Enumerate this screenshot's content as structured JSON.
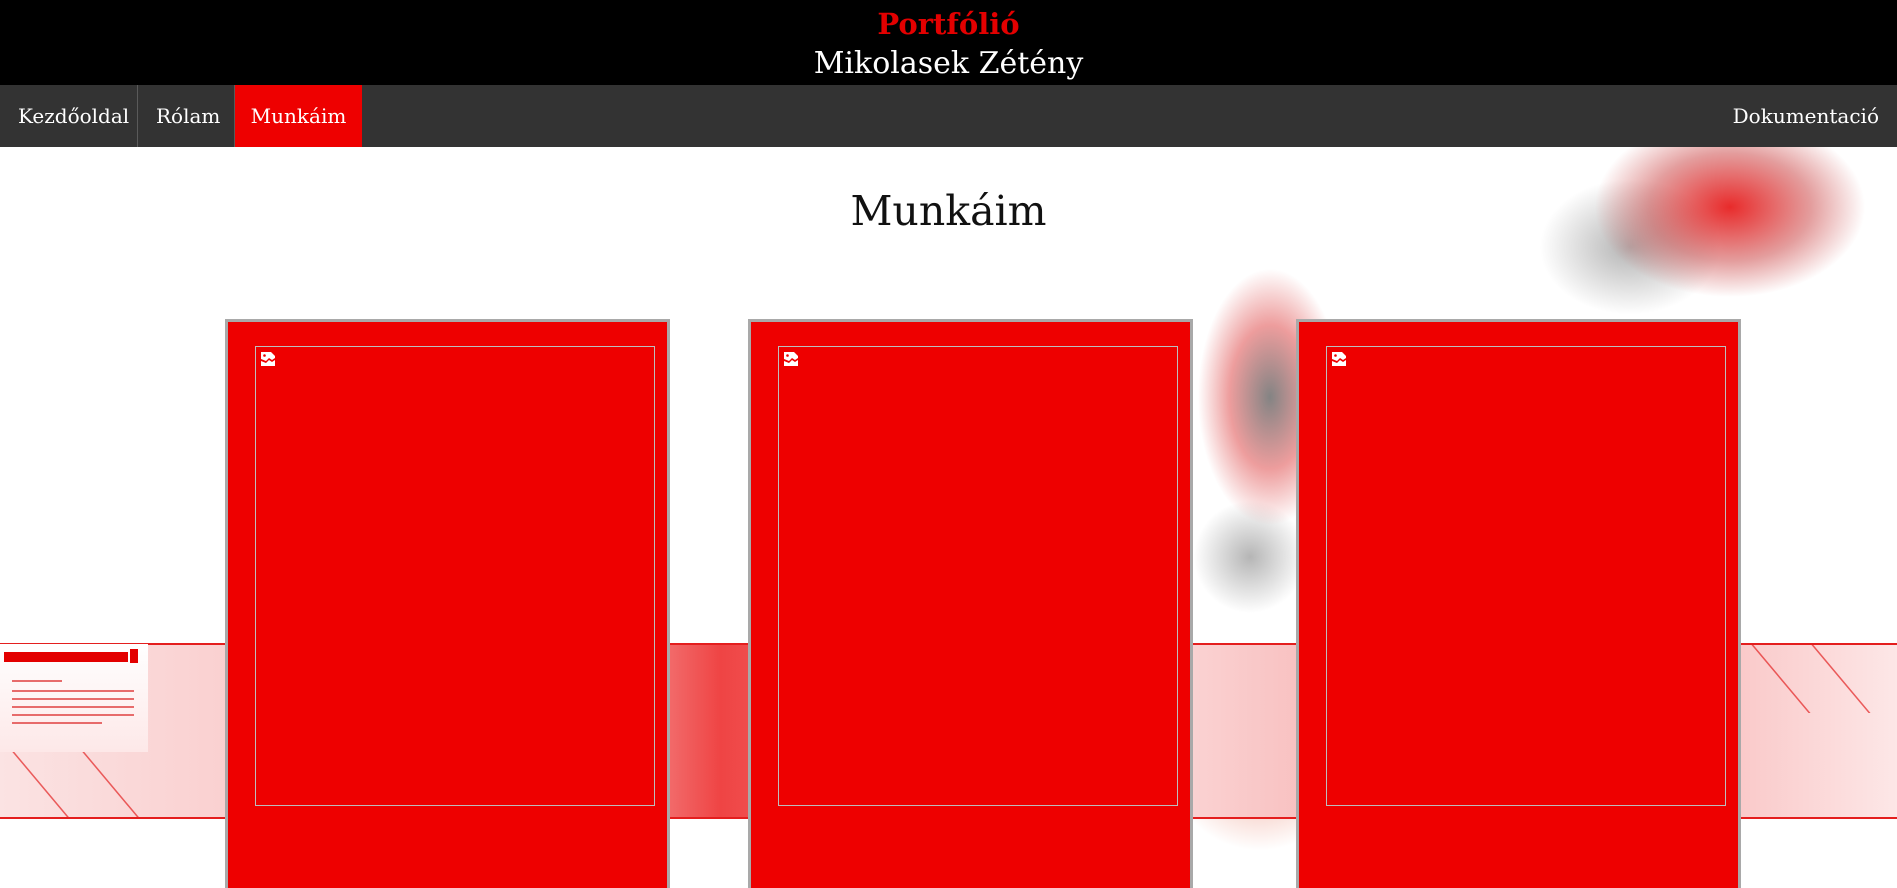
{
  "header": {
    "title": "Portfólió",
    "subtitle": "Mikolasek Zétény"
  },
  "nav": {
    "items": [
      {
        "label": "Kezdőoldal",
        "active": false
      },
      {
        "label": "Rólam",
        "active": false
      },
      {
        "label": "Munkáim",
        "active": true
      },
      {
        "label": "Dokumentació",
        "active": false
      }
    ]
  },
  "main": {
    "heading": "Munkáim",
    "cards": [
      {
        "icon": "broken-image-icon"
      },
      {
        "icon": "broken-image-icon"
      },
      {
        "icon": "broken-image-icon"
      }
    ]
  },
  "colors": {
    "accent": "#ee0000",
    "header_bg": "#000000",
    "nav_bg": "#333333",
    "title_red": "#e30000"
  }
}
